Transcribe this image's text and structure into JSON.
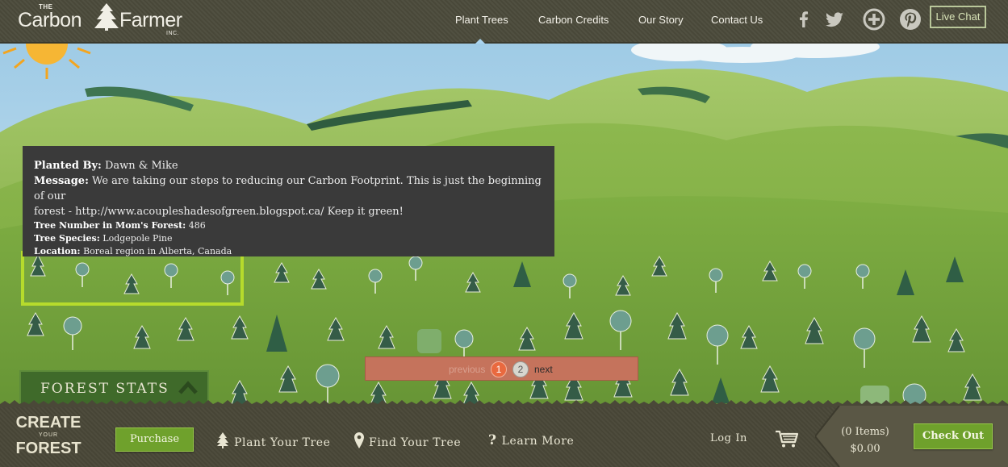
{
  "brand": {
    "the": "THE",
    "name_part1": "Carbon",
    "name_part2": "Farmer",
    "inc": "INC."
  },
  "nav": {
    "items": [
      {
        "label": "Plant Trees"
      },
      {
        "label": "Carbon Credits"
      },
      {
        "label": "Our Story"
      },
      {
        "label": "Contact Us"
      }
    ],
    "active_index": 0
  },
  "social": {
    "icons": [
      "facebook-icon",
      "twitter-icon",
      "google-plus-icon",
      "pinterest-icon"
    ]
  },
  "live_chat_label": "Live Chat",
  "tree_popup": {
    "planted_by_label": "Planted By:",
    "planted_by": "Dawn & Mike",
    "message_label": "Message:",
    "message_line1": "We are taking our steps to reducing our Carbon Footprint. This is just the beginning of our",
    "message_line2": "forest - http://www.acoupleshadesofgreen.blogspot.ca/ Keep it green!",
    "tree_number_label": "Tree Number in Mom's Forest:",
    "tree_number": "486",
    "species_label": "Tree Species:",
    "species": "Lodgepole Pine",
    "location_label": "Location:",
    "location": "Boreal region in Alberta, Canada"
  },
  "pagination": {
    "previous": "previous",
    "pages": [
      "1",
      "2"
    ],
    "current_page": "1",
    "next": "next"
  },
  "forest_stats_label": "FOREST STATS",
  "bottom_bar": {
    "create_line1": "CREATE",
    "create_line2": "YOUR",
    "create_line3": "FOREST",
    "purchase_label": "Purchase",
    "plant_your_tree": "Plant Your Tree",
    "find_your_tree": "Find Your Tree",
    "learn_more": "Learn More",
    "log_in": "Log In",
    "cart_items": "(0 Items)",
    "cart_total": "$0.00",
    "check_out": "Check Out"
  },
  "colors": {
    "header_bg": "#4b4a3b",
    "accent_green": "#6fa12c",
    "selection_green": "#b6db2c",
    "pager_bg": "#c5735c",
    "popup_bg": "#3a3a3a"
  }
}
